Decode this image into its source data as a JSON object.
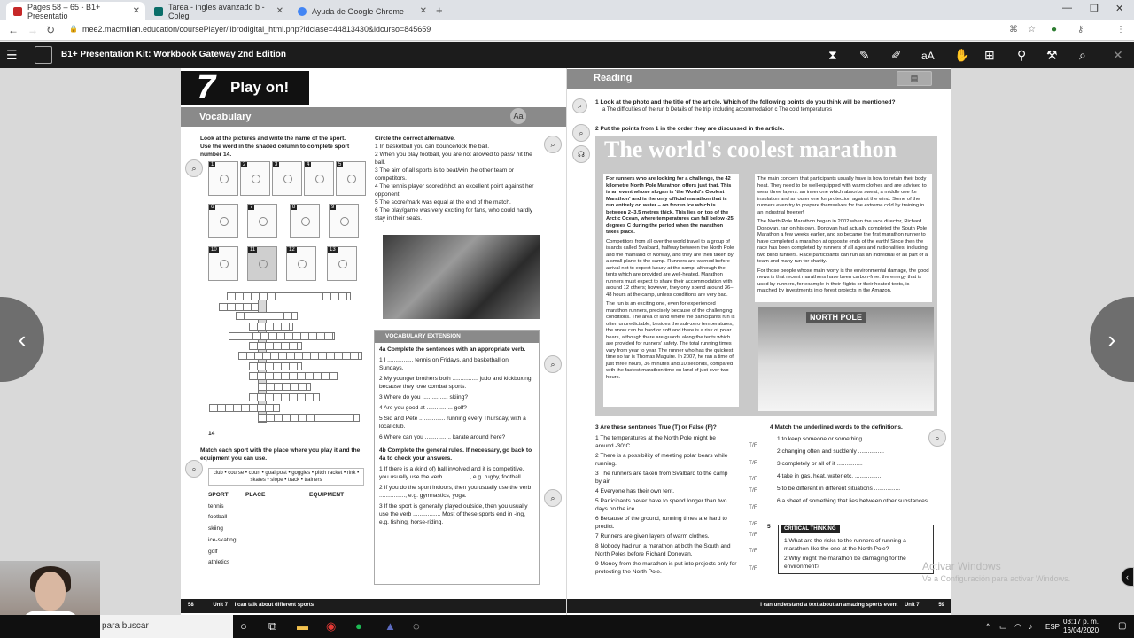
{
  "browser": {
    "tabs": [
      {
        "label": "Pages 58 – 65 - B1+ Presentatio",
        "active": true,
        "color": "#c62828"
      },
      {
        "label": "Tarea - ingles avanzado b - Coleg",
        "active": false,
        "color": "#0b6e69"
      },
      {
        "label": "Ayuda de Google Chrome",
        "active": false,
        "color": "#4285f4"
      }
    ],
    "url": "mee2.macmillan.education/coursePlayer/librodigital_html.php?idclase=44813430&idcurso=845659"
  },
  "app": {
    "title": "B1+ Presentation Kit: Workbook Gateway 2nd Edition"
  },
  "left_page": {
    "unit_number": "7",
    "unit_title": "Play on!",
    "section": "Vocabulary",
    "ex1": {
      "num": "1",
      "instruction": "Look at the pictures and write the name of the sport. Use the word in the shaded column to complete sport number 14.",
      "pic_numbers": [
        "1",
        "2",
        "3",
        "4",
        "5",
        "6",
        "7",
        "8",
        "9",
        "10",
        "11",
        "12",
        "13"
      ],
      "crossword_last": "14"
    },
    "ex2": {
      "num": "2",
      "instruction": "Match each sport with the place where you play it and the equipment you can use.",
      "wordbox": "club • course • court • goal post • goggles • pitch racket • rink • skates • slope • track • trainers",
      "columns": [
        "SPORT",
        "PLACE",
        "EQUIPMENT"
      ],
      "sports": [
        "tennis",
        "football",
        "skiing",
        "ice-skating",
        "golf",
        "athletics"
      ]
    },
    "ex3": {
      "num": "3",
      "instruction": "Circle the correct alternative.",
      "items": [
        "1  In basketball you can bounce/kick the ball.",
        "2  When you play football, you are not allowed to pass/ hit the ball.",
        "3  The aim of all sports is to beat/win the other team or competitors.",
        "4  The tennis player scored/shot an excellent point against her opponent!",
        "5  The score/mark was equal at the end of the match.",
        "6  The play/game was very exciting for fans, who could hardly stay in their seats."
      ]
    },
    "vocab_ext": {
      "header": "VOCABULARY EXTENSION",
      "ex4a": "4a Complete the sentences with an appropriate verb.",
      "items4a": [
        "1  I ................ tennis on Fridays, and basketball on Sundays.",
        "2  My younger brothers both ................ judo and kickboxing, because they love combat sports.",
        "3  Where do you ................ skiing?",
        "4  Are you good at ................ golf?",
        "5  Sid and Pete ................ running every Thursday, with a local club.",
        "6  Where can you ................ karate around here?"
      ],
      "ex4b": "4b Complete the general rules. If necessary, go back to 4a to check your answers.",
      "items4b": [
        "1  If there is a (kind of) ball involved and it is competitive, you usually use the verb ................, e.g. rugby, football.",
        "2  If you do the sport indoors, then you usually use the verb ................, e.g. gymnastics, yoga.",
        "3  If the sport is generally played outside, then you usually use the verb ................. Most of these sports end in -ing, e.g. fishing, horse-riding."
      ]
    },
    "footer": {
      "page": "58",
      "unit": "Unit 7",
      "text": "I can talk about different sports"
    }
  },
  "right_page": {
    "section": "Reading",
    "q1": "1  Look at the photo and the title of the article. Which of the following points do you think will be mentioned?",
    "q1_options": "a  The difficulties of the run        b  Details of the trip, including accommodation        c  The cold temperatures",
    "q2": "2  Put the points from 1 in the order they are discussed in the article.",
    "article_title": "The world's coolest marathon",
    "article_lead": "For runners who are looking for a challenge, the 42 kilometre North Pole Marathon offers just that. This is an event whose slogan is 'the World's Coolest Marathon' and is the only official marathon that is run entirely on water – on frozen ice which is between 2–3.5 metres thick. This lies on top of the Arctic Ocean, where temperatures can fall below -25 degrees C during the period when the marathon takes place.",
    "article_p2": "Competitors from all over the world travel to a group of islands called Svalbard, halfway between the North Pole and the mainland of Norway, and they are then taken by a small plane to the camp. Runners are warned before arrival not to expect luxury at the camp, although the tents which are provided are well-heated. Marathon runners must expect to share their accommodation with around 12 others; however, they only spend around 36–48 hours at the camp, unless conditions are very bad.",
    "article_p3": "The run is an exciting one, even for experienced marathon runners, precisely because of the challenging conditions. The area of land where the participants run is often unpredictable; besides the sub-zero temperatures, the snow can be hard or soft and there is a risk of polar bears, although there are guards along the tents which are provided for runners' safety. The total running times vary from year to year. The runner who has the quickest time so far is Thomas Maguire. In 2007, he ran a time of just three hours, 36 minutes and 10 seconds, compared with the fastest marathon time on land of just over two hours.",
    "article_r1": "The main concern that participants usually have is how to retain their body heat. They need to be well-equipped with warm clothes and are advised to wear three layers: an inner one which absorbs sweat; a middle one for insulation and an outer one for protection against the wind. Some of the runners even try to prepare themselves for the extreme cold by training in an industrial freezer!",
    "article_r2": "The North Pole Marathon began in 2002 when the race director, Richard Donovan, ran on his own. Donovan had actually completed the South Pole Marathon a few weeks earlier, and so became the first marathon runner to have completed a marathon at opposite ends of the earth! Since then the race has been completed by runners of all ages and nationalities, including two blind runners. Race participants can run as an individual or as part of a team and many run for charity.",
    "article_r3": "For those people whose main worry is the environmental damage, the good news is that recent marathons have been carbon-free: the energy that is used by runners, for example in their flights or their heated tents, is matched by investments into forest projects in the Amazon.",
    "photo_sign": "NORTH POLE",
    "q3": "3  Are these sentences True (T) or False (F)?",
    "q3_items": [
      "1  The temperatures at the North Pole might be around -30°C.",
      "2  There is a possibility of meeting polar bears while running.",
      "3  The runners are taken from Svalbard to the camp by air.",
      "4  Everyone has their own tent.",
      "5  Participants never have to spend longer than two days on the ice.",
      "6  Because of the ground, running times are hard to predict.",
      "7  Runners are given layers of warm clothes.",
      "8  Nobody had run a marathon at both the South and North Poles before Richard Donovan.",
      "9  Money from the marathon is put into projects only for protecting the North Pole."
    ],
    "tf_label": "T/F",
    "q4": "4  Match the underlined words to the definitions.",
    "q4_items": [
      "1  to keep someone or something ................",
      "2  changing often and suddenly ................",
      "3  completely or all of it ................",
      "4  take in gas, heat, water etc. ................",
      "5  to be different in different situations ................",
      "6  a sheet of something that lies between other substances ................"
    ],
    "critical": {
      "header": "CRITICAL THINKING",
      "num": "5",
      "items": [
        "1  What are the risks to the runners of running a marathon like the one at the North Pole?",
        "2  Why might the marathon be damaging for the environment?"
      ]
    },
    "footer": {
      "page": "59",
      "unit": "Unit 7",
      "text": "I can understand a text about an amazing sports event"
    }
  },
  "windows": {
    "watermark_title": "Activar Windows",
    "watermark_sub": "Ve a Configuración para activar Windows.",
    "search_placeholder": "para buscar",
    "lang": "ESP",
    "time": "03:17 p. m.",
    "date": "16/04/2020"
  }
}
